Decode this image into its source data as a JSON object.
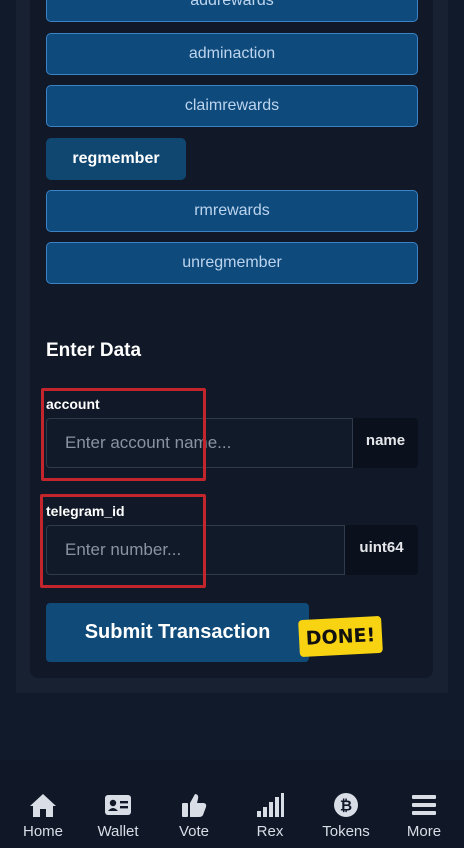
{
  "actions": [
    {
      "label": "addrewards"
    },
    {
      "label": "adminaction"
    },
    {
      "label": "claimrewards"
    },
    {
      "label": "regmember"
    },
    {
      "label": "rmrewards"
    },
    {
      "label": "unregmember"
    }
  ],
  "selected_action": "regmember",
  "form": {
    "title": "Enter Data",
    "fields": [
      {
        "label": "account",
        "placeholder": "Enter account name...",
        "type": "name"
      },
      {
        "label": "telegram_id",
        "placeholder": "Enter number...",
        "type": "uint64"
      }
    ],
    "submit_label": "Submit Transaction",
    "done_badge": "DONE!"
  },
  "nav": {
    "items": [
      {
        "label": "Home",
        "icon": "home-icon"
      },
      {
        "label": "Wallet",
        "icon": "wallet-icon"
      },
      {
        "label": "Vote",
        "icon": "thumbs-up-icon"
      },
      {
        "label": "Rex",
        "icon": "signal-bars-icon"
      },
      {
        "label": "Tokens",
        "icon": "bitcoin-icon"
      },
      {
        "label": "More",
        "icon": "menu-icon"
      }
    ]
  },
  "colors": {
    "background": "#111a2a",
    "card": "#111827",
    "action_button": "#0e4a7c",
    "action_border": "#3b82c6",
    "highlight_box": "#c3252d",
    "done_badge": "#f7d312"
  }
}
